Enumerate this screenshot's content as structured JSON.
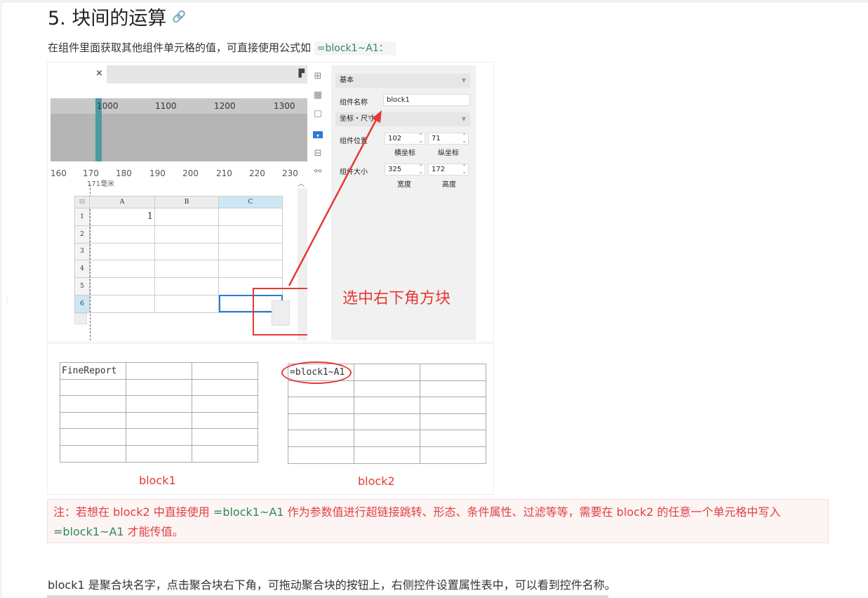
{
  "heading": "5. 块间的运算",
  "intro": {
    "text": "在组件里面获取其他组件单元格的值，可直接使用公式如 ",
    "code": "=block1~A1",
    "suffix": "："
  },
  "designer": {
    "close_glyph": "×",
    "ruler_top": [
      "1000",
      "1100",
      "1200",
      "1300"
    ],
    "ruler_bottom": [
      "160",
      "170",
      "180",
      "190",
      "200",
      "210",
      "220",
      "230"
    ],
    "ruler_unit": "171毫米",
    "columns": [
      "A",
      "B",
      "C"
    ],
    "rows": [
      "1",
      "2",
      "3",
      "4",
      "5",
      "6"
    ],
    "cell_a1": "1"
  },
  "panel": {
    "section_basic": "基本",
    "name_label": "组件名称",
    "name_value": "block1",
    "section_coord": "坐标・尺寸",
    "position_label": "组件位置",
    "x_value": "102",
    "y_value": "71",
    "x_caption": "横坐标",
    "y_caption": "纵坐标",
    "size_label": "组件大小",
    "w_value": "325",
    "h_value": "172",
    "w_caption": "宽度",
    "h_caption": "高度"
  },
  "annotation": "选中右下角方块",
  "blocks": {
    "block1_cell": "FineReport",
    "block2_cell": "=block1~A1",
    "block1_caption": "block1",
    "block2_caption": "block2"
  },
  "note": {
    "p1": "注：若想在 block2 中直接使用 ",
    "code1": "=block1~A1",
    "p2": " 作为参数值进行超链接跳转、形态、条件属性、过滤等等，需要在 block2 的任意一个单元格中写入 ",
    "code2": "=block1~A1",
    "p3": " 才能传值。"
  },
  "paragraph2": "block1 是聚合块名字，点击聚合块右下角，可拖动聚合块的按钮上，右侧控件设置属性表中，可以看到控件名称。",
  "colors": {
    "accent_red": "#e53935",
    "code_green": "#2e8b57",
    "select_blue": "#2b7bd6"
  }
}
